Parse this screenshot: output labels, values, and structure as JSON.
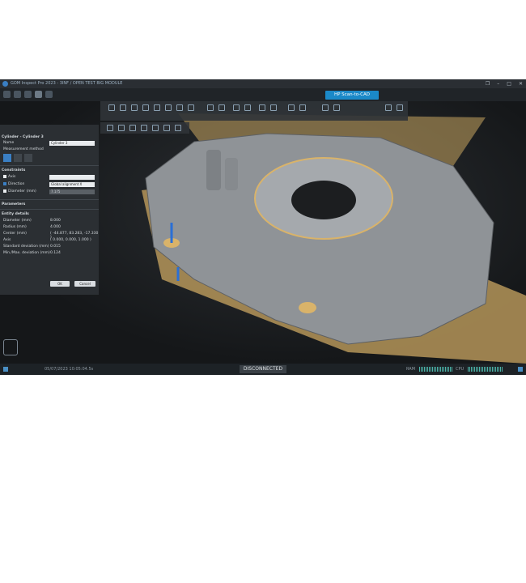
{
  "titlebar": {
    "title": "GOM Inspect Pro 2023 - 3INF / OPEN TEST BIG MODULE"
  },
  "scan_button": {
    "label": "HP Scan-to-CAD"
  },
  "panel": {
    "header": "Cylinder - Cylinder 3",
    "name_label": "Name",
    "name_value": "Cylinder 3",
    "measurement_method": "Measurement method",
    "constraints_title": "Constraints",
    "axis_label": "Axis",
    "direction_label": "Direction",
    "direction_value": "Global alignment X",
    "diameter_label": "Diameter (mm)",
    "diameter_input": "7.175",
    "parameters_title": "Parameters",
    "entity_details_title": "Entity details",
    "details": [
      {
        "label": "Diameter (mm)",
        "value": "8.000"
      },
      {
        "label": "Radius (mm)",
        "value": "4.000"
      },
      {
        "label": "Center (mm)",
        "value": "( -44.877, 83.283, -17.330 )"
      },
      {
        "label": "Axis",
        "value": "( 0.000, 0.000, 1.000 )"
      },
      {
        "label": "Standard deviation (mm)",
        "value": "0.015"
      },
      {
        "label": "Min./Max. deviation (mm)",
        "value": "0.124"
      }
    ],
    "ok": "OK",
    "cancel": "Cancel"
  },
  "status": {
    "left": "05/07/2023 10:05:04.5s",
    "center": "DISCONNECTED",
    "ram": "RAM",
    "cpu": "CPU"
  },
  "colors": {
    "accent": "#1b89c8",
    "plane": "#d9b36a",
    "part": "#9a9ea2"
  }
}
